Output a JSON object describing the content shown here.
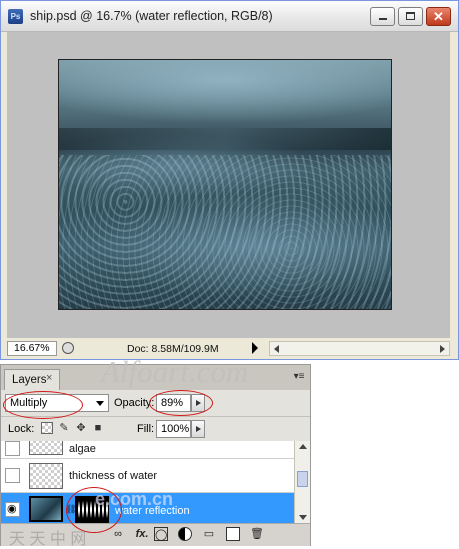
{
  "document_window": {
    "app_icon": "photoshop-icon",
    "title": "ship.psd @ 16.7% (water reflection, RGB/8)",
    "buttons": {
      "minimize": "minimize-icon",
      "maximize": "maximize-icon",
      "close": "✕"
    },
    "status": {
      "zoom": "16.67%",
      "doc_size": "Doc: 8.58M/109.9M"
    }
  },
  "watermarks": {
    "main": "Alfoart.com",
    "secondary": "e.com.cn",
    "tertiary": "天 天 中 网"
  },
  "layers_panel": {
    "tab_label": "Layers",
    "tab_close": "×",
    "blend_mode": "Multiply",
    "opacity_label": "Opacity:",
    "opacity_value": "89%",
    "lock_label": "Lock:",
    "fill_label": "Fill:",
    "fill_value": "100%",
    "layers": [
      {
        "name": "algae",
        "visible": false,
        "selected": false
      },
      {
        "name": "thickness of water",
        "visible": false,
        "selected": false
      },
      {
        "name": "water reflection",
        "visible": true,
        "selected": true
      }
    ],
    "footer_icons": [
      "link-icon",
      "fx-icon",
      "mask-icon",
      "adjustment-icon",
      "group-icon",
      "new-layer-icon",
      "trash-icon"
    ],
    "fx_label": "fx."
  },
  "colors": {
    "selected_layer": "#3399ff",
    "annotation_red": "#d01818"
  }
}
